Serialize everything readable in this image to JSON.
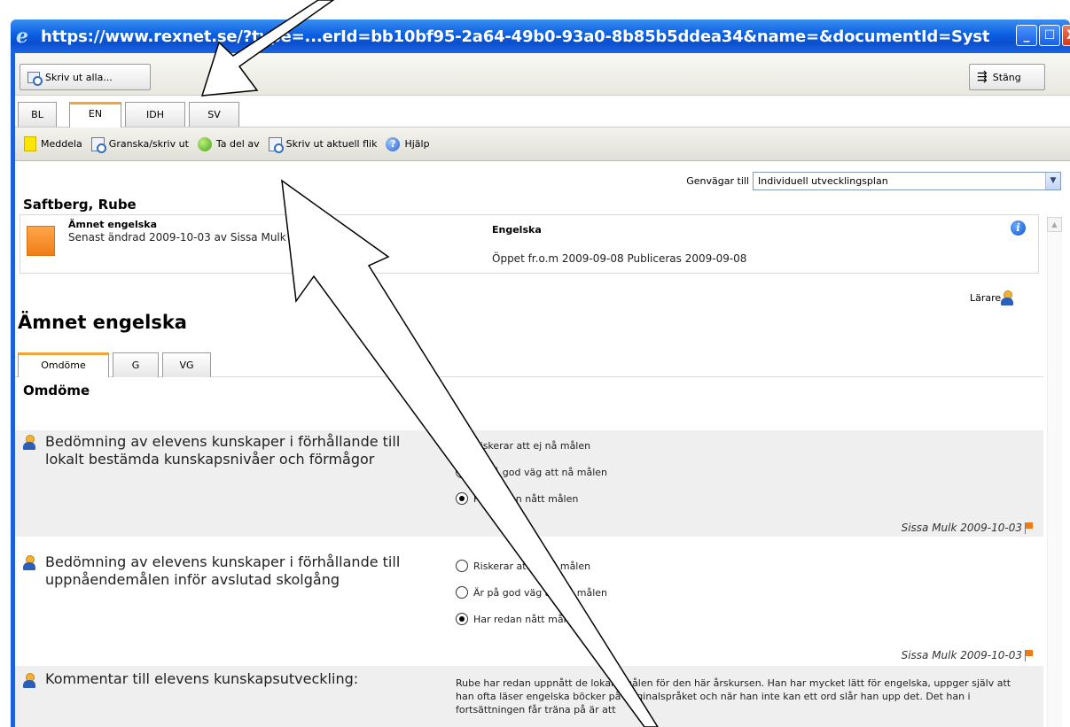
{
  "window": {
    "title": "https://www.rexnet.se/?type=...erId=bb10bf95-2a64-49b0-93a0-8b85b5ddea34&name=&documentId=Syste -...",
    "buttons": {
      "minimize": "_",
      "maximize": "☐",
      "close": "X"
    }
  },
  "toolbar": {
    "print_all_label": "Skriv ut alla...",
    "close_label": "Stäng"
  },
  "tabs": [
    {
      "label": "BL",
      "active": false
    },
    {
      "label": "EN",
      "active": true
    },
    {
      "label": "IDH",
      "active": false
    },
    {
      "label": "SV",
      "active": false
    }
  ],
  "actions": {
    "notify": "Meddela",
    "review_print": "Granska/skriv ut",
    "take_part": "Ta del av",
    "print_current": "Skriv ut aktuell flik",
    "help": "Hjälp"
  },
  "shortcut": {
    "label": "Genvägar till",
    "selected": "Individuell utvecklingsplan"
  },
  "student": {
    "name": "Saftberg, Rube"
  },
  "info": {
    "subject": "Ämnet engelska",
    "changed": "Senast ändrad 2009-10-03 av Sissa Mulk",
    "course": "Engelska",
    "open": "Öppet fr.o.m 2009-09-08  Publiceras 2009-09-08",
    "info_icon": "i"
  },
  "teacher_label": "Lärare",
  "subject_title": "Ämnet engelska",
  "subtabs": [
    {
      "label": "Omdöme",
      "active": true
    },
    {
      "label": "G",
      "active": false
    },
    {
      "label": "VG",
      "active": false
    }
  ],
  "section_title": "Omdöme",
  "assessments": [
    {
      "question": "Bedömning av elevens kunskaper i förhållande till lokalt bestämda kunskapsnivåer och förmågor",
      "options": [
        "Riskerar att ej nå målen",
        "Är på god väg att nå målen",
        "Har redan nått målen"
      ],
      "selected": 2,
      "signoff": "Sissa Mulk 2009-10-03"
    },
    {
      "question": "Bedömning av elevens kunskaper i förhållande till uppnåendemålen inför avslutad skolgång",
      "options": [
        "Riskerar att ej nå målen",
        "Är på god väg att nå målen",
        "Har redan nått målen"
      ],
      "selected": 2,
      "signoff": "Sissa Mulk 2009-10-03"
    }
  ],
  "comment": {
    "label": "Kommentar till elevens kunskapsutveckling:",
    "text": "Rube har redan uppnått de lokala målen för den här årskursen. Han har mycket lätt för engelska, uppger själv att han ofta läser engelska böcker på originalspråket och när han inte kan ett ord slår han upp det. Det han i fortsättningen får träna på är att"
  },
  "colors": {
    "titlebar": "#0b5fe0",
    "tab_accent": "#f2a536",
    "orange": "#f07d18"
  }
}
